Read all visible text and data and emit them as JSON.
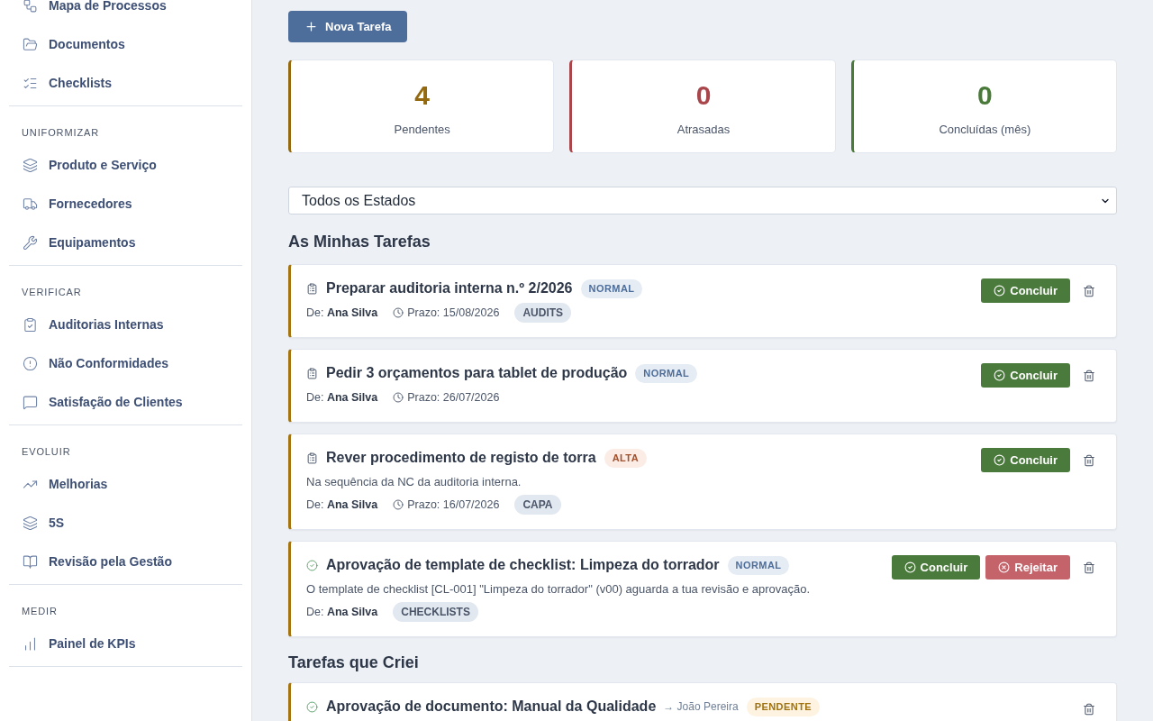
{
  "sidebar": {
    "groups": [
      {
        "items": [
          "Mapa de Processos",
          "Documentos",
          "Checklists"
        ]
      },
      {
        "title": "UNIFORMIZAR",
        "items": [
          "Produto e Serviço",
          "Fornecedores",
          "Equipamentos"
        ]
      },
      {
        "title": "VERIFICAR",
        "items": [
          "Auditorias Internas",
          "Não Conformidades",
          "Satisfação de Clientes"
        ]
      },
      {
        "title": "EVOLUIR",
        "items": [
          "Melhorias",
          "5S",
          "Revisão pela Gestão"
        ]
      },
      {
        "title": "MEDIR",
        "items": [
          "Painel de KPIs"
        ]
      }
    ]
  },
  "new_task_button": "Nova Tarefa",
  "stats": [
    {
      "value": "4",
      "label": "Pendentes",
      "color": "#94690f"
    },
    {
      "value": "0",
      "label": "Atrasadas",
      "color": "#a9464b"
    },
    {
      "value": "0",
      "label": "Concluídas (mês)",
      "color": "#4a7a3a"
    }
  ],
  "status_filter": {
    "value": "Todos os Estados"
  },
  "sections": [
    {
      "title": "As Minhas Tarefas",
      "tasks": [
        {
          "kind": "task",
          "title": "Preparar auditoria interna n.º 2/2026",
          "badge": {
            "label": "NORMAL",
            "kind": "normal"
          },
          "author": "De: **Ana Silva**",
          "due": "Prazo: 15/08/2026",
          "tag": "AUDITS",
          "actions": [
            {
              "label": "Concluir",
              "kind": "complete"
            }
          ]
        },
        {
          "kind": "task",
          "title": "Pedir 3 orçamentos para tablet de produção",
          "badge": {
            "label": "NORMAL",
            "kind": "normal"
          },
          "author": "De: **Ana Silva**",
          "due": "Prazo: 26/07/2026",
          "actions": [
            {
              "label": "Concluir",
              "kind": "complete"
            }
          ]
        },
        {
          "kind": "task",
          "title": "Rever procedimento de registo de torra",
          "badge": {
            "label": "ALTA",
            "kind": "high"
          },
          "description": "Na sequência da NC da auditoria interna.",
          "author": "De: **Ana Silva**",
          "due": "Prazo: 16/07/2026",
          "tag": "CAPA",
          "actions": [
            {
              "label": "Concluir",
              "kind": "complete"
            }
          ]
        },
        {
          "kind": "approval",
          "title": "Aprovação de template de checklist: Limpeza do torrador",
          "badge": {
            "label": "NORMAL",
            "kind": "normal"
          },
          "description": "O template de checklist [CL-001] \"Limpeza do torrador\" (v00) aguarda a tua revisão e aprovação.",
          "author": "De: **Ana Silva**",
          "tag": "CHECKLISTS",
          "actions": [
            {
              "label": "Concluir",
              "kind": "complete"
            },
            {
              "label": "Rejeitar",
              "kind": "reject"
            }
          ]
        }
      ]
    },
    {
      "title": "Tarefas que Criei",
      "tasks": [
        {
          "kind": "approval",
          "title": "Aprovação de documento: Manual da Qualidade",
          "assignee": "→ João Pereira",
          "badge": {
            "label": "PENDENTE",
            "kind": "pending"
          }
        }
      ]
    }
  ]
}
